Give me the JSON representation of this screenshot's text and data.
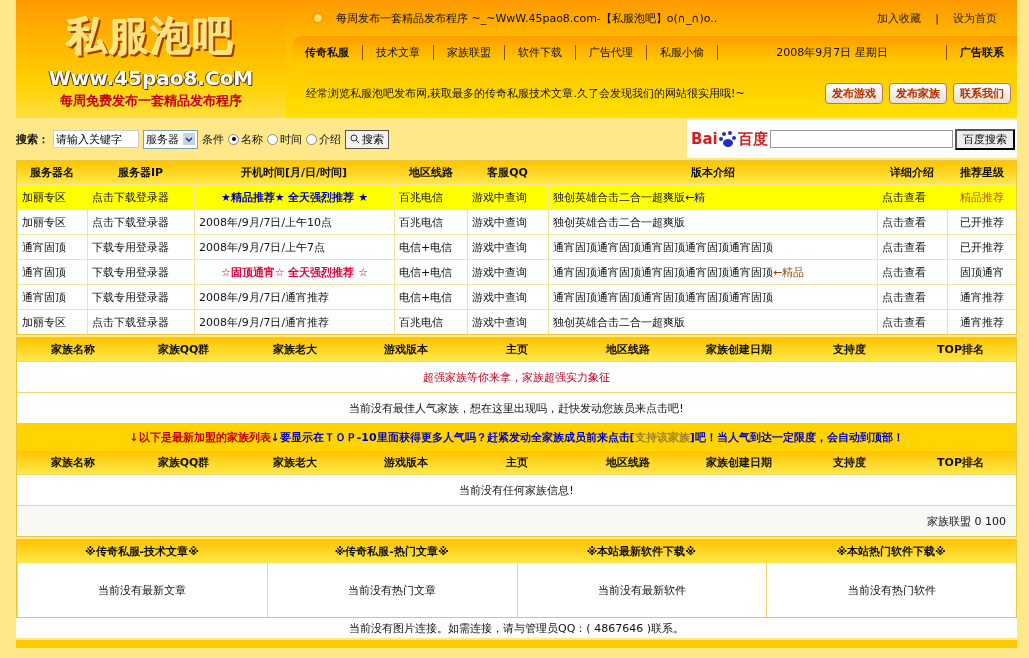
{
  "logo": {
    "title": "私服泡吧",
    "url": "Www.45pao8.CoM",
    "slogan": "每周免费发布一套精品发布程序"
  },
  "marquee": "每周发布一套精品发布程序 ~_~WwW.45pao8.com-【私服泡吧】o(∩_∩)o..",
  "top_links": [
    "加入收藏",
    "设为首页"
  ],
  "top_separator": "|",
  "nav": [
    {
      "label": "传奇私服",
      "kind": "bold"
    },
    {
      "label": "技术文章",
      "kind": "link"
    },
    {
      "label": "家族联盟",
      "kind": "link"
    },
    {
      "label": "软件下载",
      "kind": "link"
    },
    {
      "label": "广告代理",
      "kind": "link"
    },
    {
      "label": "私服小偷",
      "kind": "link"
    },
    {
      "label": "2008年9月7日  星期日",
      "kind": "date"
    },
    {
      "label": "广告联系",
      "kind": "bold"
    }
  ],
  "tagline": "经常浏览私服泡吧发布网,获取最多的传奇私服技术文章.久了会发现我们的网站很实用哦!~",
  "action_buttons": [
    "发布游戏",
    "发布家族",
    "联系我们"
  ],
  "search": {
    "label": "搜索：",
    "value": "请输入关键字",
    "select": "服务器",
    "condition": "条件",
    "options": [
      {
        "label": "名称",
        "selected": true
      },
      {
        "label": "时间",
        "selected": false
      },
      {
        "label": "介绍",
        "selected": false
      }
    ],
    "button": "搜索"
  },
  "baidu": {
    "logo_latin": "Bai",
    "logo_cjk": "百度",
    "button": "百度搜索"
  },
  "servers": {
    "columns": [
      "服务器名",
      "服务器IP",
      "开机时间[月/日/时间]",
      "地区线路",
      "客服QQ",
      "版本介绍",
      "详细介绍",
      "推荐星级"
    ],
    "rows": [
      {
        "highlighted": true,
        "color": "#0000aa",
        "cells": [
          "加丽专区",
          "点击下载登录器",
          "★精品推荐★ 全天强烈推荐 ★",
          "百兆电信",
          "游戏中查询",
          "独创英雄合击二合一超爽版",
          "点击查看",
          "精品推荐"
        ],
        "tag": "←精"
      },
      {
        "highlighted": false,
        "cells": [
          "加丽专区",
          "点击下载登录器",
          "2008年/9月/7日/上午10点",
          "百兆电信",
          "游戏中查询",
          "独创英雄合击二合一超爽版",
          "点击查看",
          "已开推荐"
        ]
      },
      {
        "highlighted": false,
        "cells": [
          "通宵固顶",
          "下载专用登录器",
          "2008年/9月/7日/上午7点",
          "电信+电信",
          "游戏中查询",
          "通宵固顶通宵固顶通宵固顶通宵固顶通宵固顶",
          "点击查看",
          "已开推荐"
        ]
      },
      {
        "highlighted": false,
        "color": "#e0003a",
        "cells": [
          "通宵固顶",
          "下载专用登录器",
          "☆固顶通宵☆ 全天强烈推荐 ☆",
          "电信+电信",
          "游戏中查询",
          "通宵固顶通宵固顶通宵固顶通宵固顶通宵固顶",
          "点击查看",
          "固顶通宵"
        ],
        "tag": "←精品"
      },
      {
        "highlighted": false,
        "cells": [
          "通宵固顶",
          "下载专用登录器",
          "2008年/9月/7日/通宵推荐",
          "电信+电信",
          "游戏中查询",
          "通宵固顶通宵固顶通宵固顶通宵固顶通宵固顶",
          "点击查看",
          "通宵推荐"
        ]
      },
      {
        "highlighted": false,
        "cells": [
          "加丽专区",
          "点击下载登录器",
          "2008年/9月/7日/通宵推荐",
          "百兆电信",
          "游戏中查询",
          "独创英雄合击二合一超爽版",
          "点击查看",
          "通宵推荐"
        ]
      }
    ]
  },
  "family_columns": [
    "家族名称",
    "家族QQ群",
    "家族老大",
    "游戏版本",
    "主页",
    "地区线路",
    "家族创建日期",
    "支持度",
    "TOP排名"
  ],
  "family_banner": "超强家族等你来拿，家族超强实力象征",
  "family_top_message": "当前没有最佳人气家族，想在这里出现吗，赶快发动您族员来点击吧!",
  "notice": [
    {
      "kind": "red",
      "text": "↓以下是最新加盟的家族列表"
    },
    {
      "kind": "blue",
      "text": "↓要显示在ＴＯＰ-10里面获得更多人气吗？赶紧发动全家族成员前来点击["
    },
    {
      "kind": "link",
      "text": "支持该家族"
    },
    {
      "kind": "blue",
      "text": "]吧！当人气到达一定限度，会自动到顶部！"
    }
  ],
  "family_columns_2": [
    "家族名称",
    "家族QQ群",
    "家族老大",
    "游戏版本",
    "主页",
    "地区线路",
    "家族创建日期",
    "支持度",
    "TOP排名"
  ],
  "family_empty": "当前没有任何家族信息!",
  "pager": "家族联盟  0  100",
  "articles": [
    {
      "title": "※传奇私服-技术文章※",
      "empty": "当前没有最新文章"
    },
    {
      "title": "※传奇私服-热门文章※",
      "empty": "当前没有热门文章"
    },
    {
      "title": "※本站最新软件下载※",
      "empty": "当前没有最新软件"
    },
    {
      "title": "※本站热门软件下载※",
      "empty": "当前没有热门软件"
    }
  ],
  "footer": "当前没有图片连接。如需连接，请与管理员QQ：( 4867646 )联系。"
}
